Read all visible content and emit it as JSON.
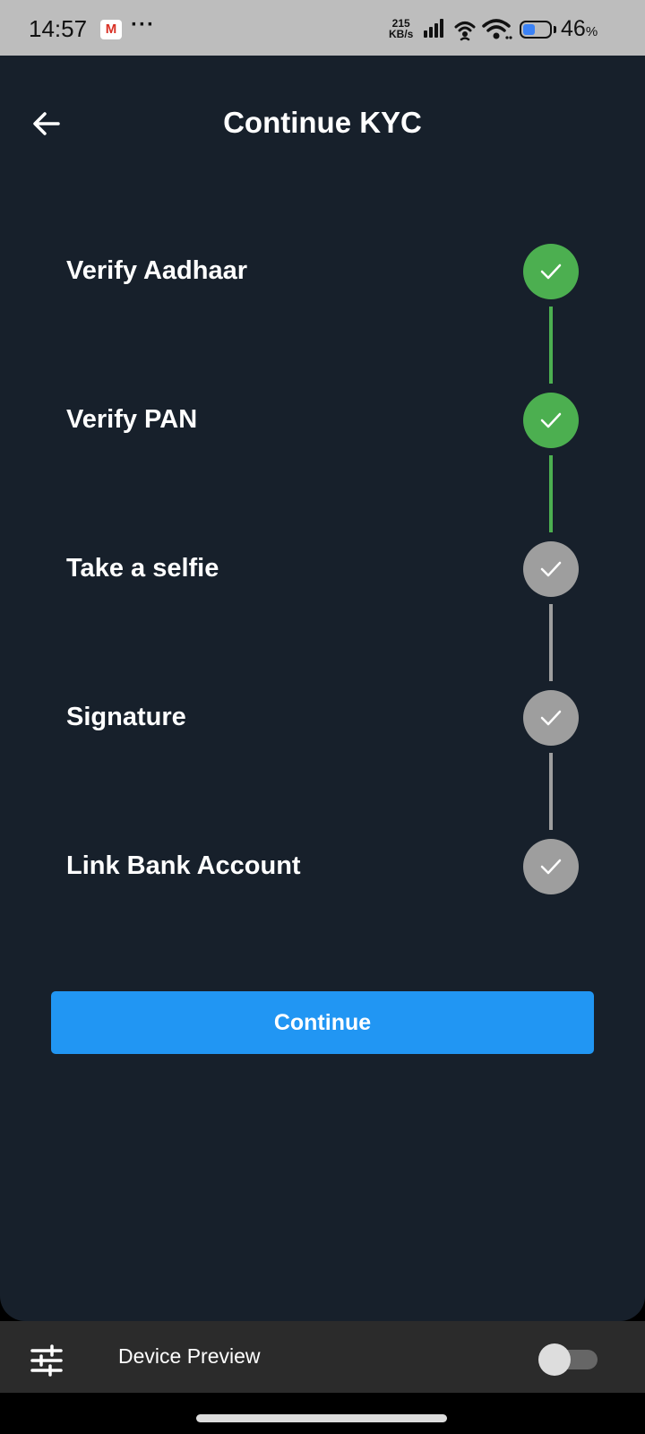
{
  "status_bar": {
    "time": "14:57",
    "gmail": "M",
    "more": "···",
    "net_speed_value": "215",
    "net_speed_unit": "KB/s",
    "battery_percent": "46",
    "battery_unit": "%",
    "battery_fill": 0.46,
    "battery_color": "#3b82f6"
  },
  "header": {
    "title": "Continue KYC",
    "back_icon": "arrow-left-icon"
  },
  "steps": [
    {
      "label": "Verify Aadhaar",
      "status": "completed"
    },
    {
      "label": "Verify PAN",
      "status": "completed"
    },
    {
      "label": "Take a selfie",
      "status": "pending"
    },
    {
      "label": "Signature",
      "status": "pending"
    },
    {
      "label": "Link Bank Account",
      "status": "pending"
    }
  ],
  "colors": {
    "background": "#17202b",
    "completed": "#4caf50",
    "pending": "#9e9e9e",
    "primary": "#2196f3"
  },
  "continue_button": {
    "label": "Continue"
  },
  "bottom_bar": {
    "label": "Device Preview",
    "icon": "tune-icon",
    "toggle_on": false
  }
}
